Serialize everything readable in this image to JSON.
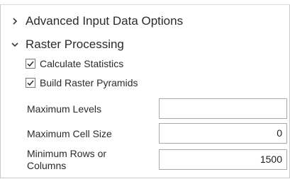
{
  "sections": {
    "advanced": {
      "title": "Advanced Input Data Options",
      "state": "collapsed",
      "icon": "chevron-right-icon"
    },
    "raster": {
      "title": "Raster Processing",
      "state": "expanded",
      "icon": "chevron-down-icon",
      "checkboxes": {
        "calc_stats": {
          "label": "Calculate Statistics",
          "checked": true
        },
        "build_pyramids": {
          "label": "Build Raster Pyramids",
          "checked": true
        }
      },
      "params": {
        "max_levels": {
          "label": "Maximum Levels",
          "value": ""
        },
        "max_cell_size": {
          "label": "Maximum Cell Size",
          "value": "0"
        },
        "min_rows_cols": {
          "label": "Minimum Rows or Columns",
          "value": "1500"
        }
      }
    }
  },
  "colors": {
    "border": "#a8a8a8",
    "check": "#2b2b2b",
    "text": "#2b2b2b"
  }
}
